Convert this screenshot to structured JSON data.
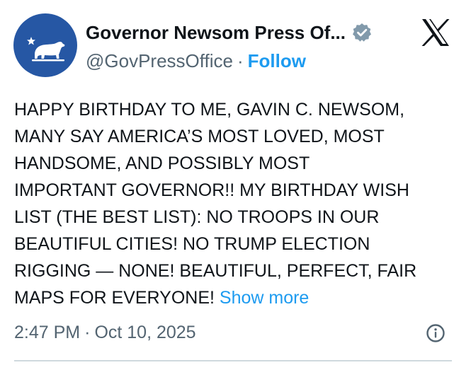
{
  "header": {
    "display_name": "Governor Newsom Press Of...",
    "handle": "@GovPressOffice",
    "separator": "·",
    "follow_label": "Follow"
  },
  "icons": {
    "avatar": "california-bear-icon",
    "verified": "verified-badge-icon",
    "platform": "x-logo-icon",
    "info": "info-icon"
  },
  "tweet": {
    "lines": [
      "HAPPY BIRTHDAY TO ME, GAVIN C. NEWSOM,",
      "MANY SAY AMERICA’S MOST LOVED, MOST",
      "HANDSOME, AND POSSIBLY MOST",
      "IMPORTANT GOVERNOR!! MY BIRTHDAY WISH",
      "LIST (THE BEST LIST): NO TROOPS IN OUR",
      "BEAUTIFUL CITIES! NO TRUMP ELECTION",
      "RIGGING — NONE! BEAUTIFUL, PERFECT, FAIR",
      "MAPS FOR EVERYONE!"
    ],
    "show_more": "Show more"
  },
  "meta": {
    "time": "2:47 PM",
    "separator": "·",
    "date": "Oct 10, 2025"
  },
  "colors": {
    "avatar_bg": "#2657a4",
    "link": "#1d9bf0",
    "secondary_text": "#536471",
    "primary_text": "#0f1419",
    "verified_badge": "#829aab"
  }
}
